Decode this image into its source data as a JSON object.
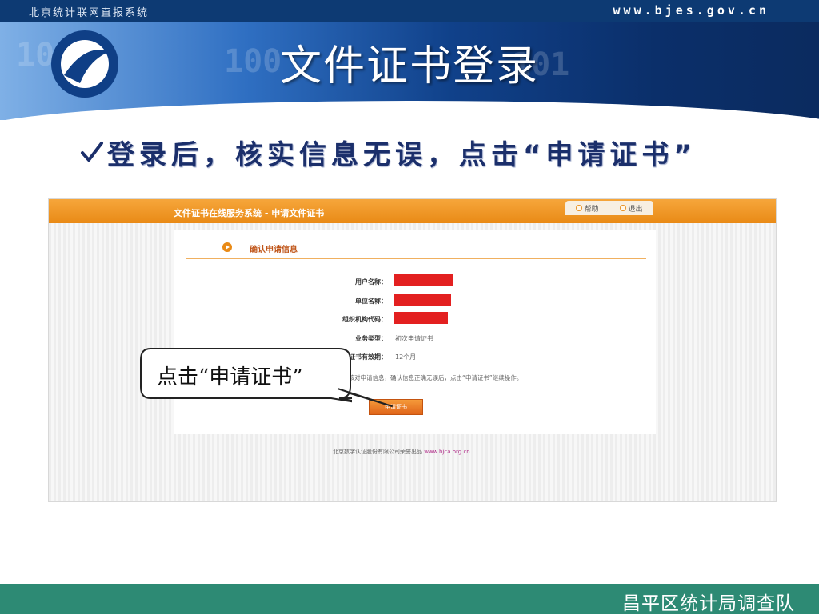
{
  "header": {
    "org_name": "北京统计联网直报系统",
    "site_url": "www.bjes.gov.cn",
    "slide_title": "文件证书登录"
  },
  "instruction": {
    "icon": "check-icon",
    "text": "登录后，核实信息无误，点击“申请证书”"
  },
  "screenshot": {
    "header_title": "文件证书在线服务系统 - 申请文件证书",
    "tabs": [
      {
        "label": "帮助",
        "icon": "circle-icon"
      },
      {
        "label": "退出",
        "icon": "circle-icon"
      }
    ],
    "section_title": "确认申请信息",
    "fields": [
      {
        "label": "用户名称：",
        "value": "",
        "redacted": true
      },
      {
        "label": "单位名称：",
        "value": "",
        "redacted": true
      },
      {
        "label": "组织机构代码：",
        "value": "",
        "redacted": true
      },
      {
        "label": "业务类型：",
        "value": "初次申请证书",
        "redacted": false
      },
      {
        "label": "证书有效期：",
        "value": "12个月",
        "redacted": false
      }
    ],
    "note": "请核对申请信息，确认信息正确无误后，点击“申请证书”继续操作。",
    "apply_button": "申请证书",
    "footer_text": "北京数字认证股份有限公司荣誉出品",
    "footer_link": "www.bjca.org.cn"
  },
  "callout": {
    "text": "点击“申请证书”"
  },
  "footer": {
    "text": "昌平区统计局调查队"
  },
  "colors": {
    "top_bar": "#0d3a73",
    "banner_accent": "#2f6fc2",
    "instruction_text": "#1b2f6b",
    "screenshot_header": "#e98a16",
    "redaction": "#e32020",
    "bottom_bar": "#2d8a74"
  }
}
